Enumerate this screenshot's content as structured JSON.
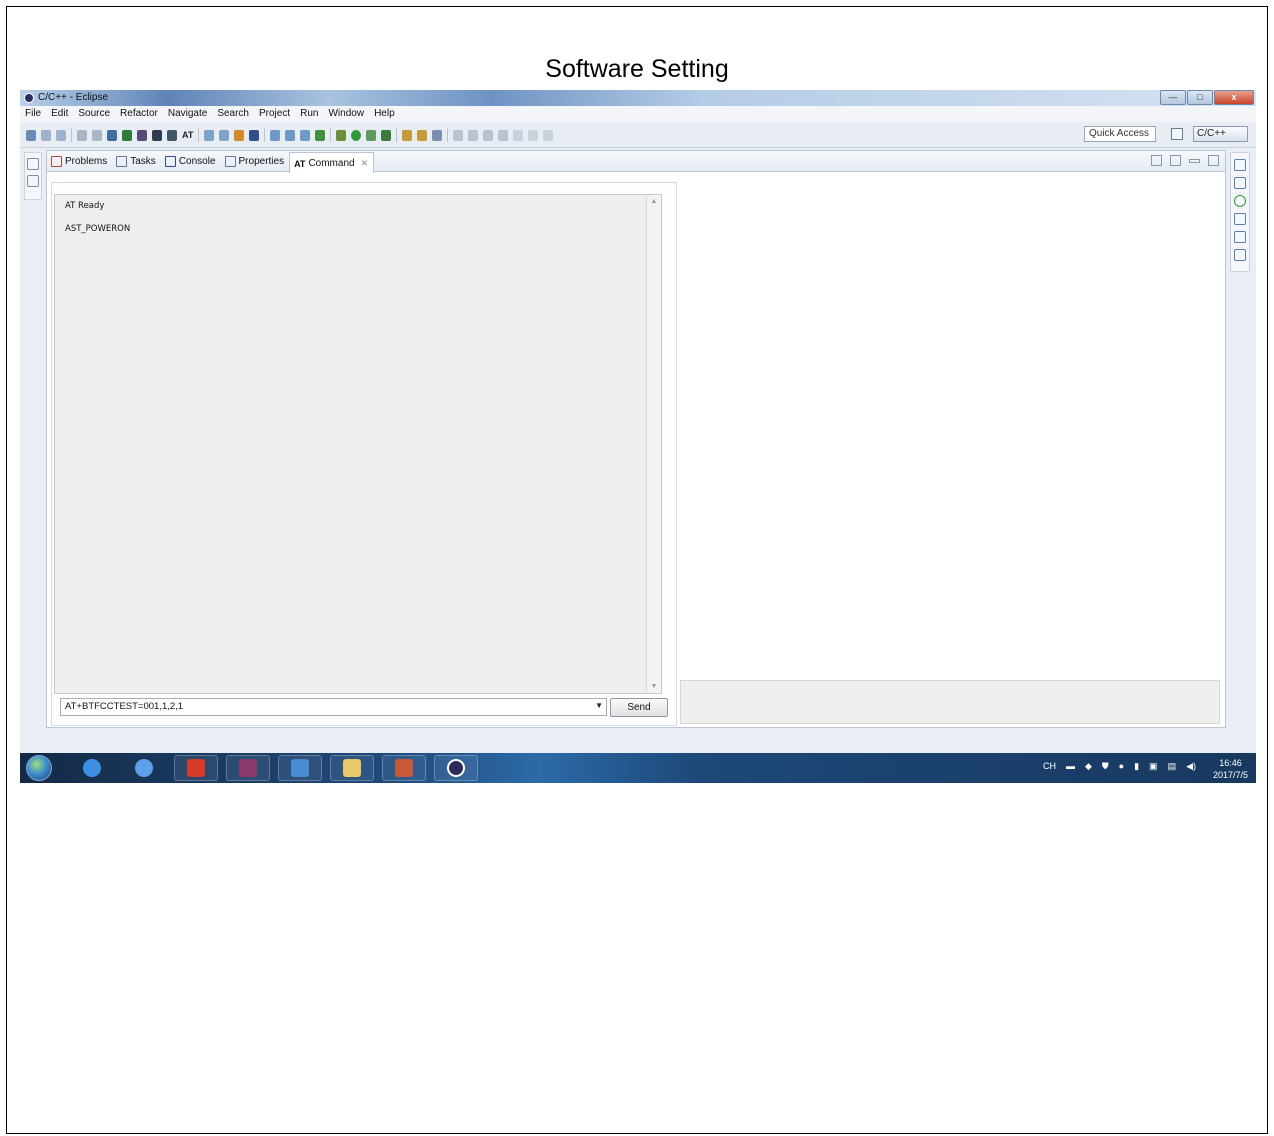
{
  "document": {
    "title": "Software Setting"
  },
  "window": {
    "title": "C/C++ - Eclipse",
    "buttons": {
      "minimize": "—",
      "maximize": "□",
      "close": "x"
    }
  },
  "menu": [
    "File",
    "Edit",
    "Source",
    "Refactor",
    "Navigate",
    "Search",
    "Project",
    "Run",
    "Window",
    "Help"
  ],
  "toolbar": {
    "quick_access": "Quick Access",
    "perspective": "C/C++",
    "at_label": "AT"
  },
  "tabs": [
    {
      "label": "Problems",
      "icon": "problems-icon"
    },
    {
      "label": "Tasks",
      "icon": "tasks-icon"
    },
    {
      "label": "Console",
      "icon": "console-icon"
    },
    {
      "label": "Properties",
      "icon": "properties-icon"
    },
    {
      "label": "Command",
      "icon": "at-icon",
      "prefix": "AT",
      "active": true
    }
  ],
  "output": {
    "lines": [
      "AT Ready",
      "AST_POWERON"
    ]
  },
  "command": {
    "value": "AT+BTFCCTEST=001,1,2,1",
    "send_label": "Send"
  },
  "taskbar": {
    "apps": [
      "ie-icon",
      "ie-icon",
      "flash-icon",
      "winrar-icon",
      "network-icon",
      "folder-icon",
      "tool-icon",
      "eclipse-icon"
    ],
    "tray_lang": "CH",
    "clock_time": "16:46",
    "clock_date": "2017/7/5"
  }
}
